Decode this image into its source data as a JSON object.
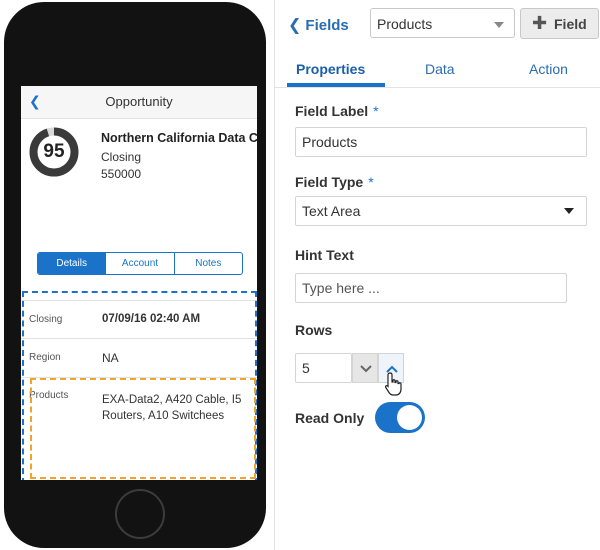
{
  "phone": {
    "header_title": "Opportunity",
    "score": "95",
    "score_fraction": 0.95,
    "opportunity_name": "Northern California Data C",
    "stage": "Closing",
    "amount": "550000",
    "segments": [
      "Details",
      "Account",
      "Notes"
    ],
    "active_segment": "Details",
    "rows": [
      {
        "label": "Closing",
        "value": "07/09/16 02:40 AM"
      },
      {
        "label": "Region",
        "value": "NA"
      }
    ],
    "products_label": "Products",
    "products_value": "EXA-Data2, A420 Cable, I5 Routers, A10 Switchees"
  },
  "panel": {
    "back_label": "Fields",
    "field_select": "Products",
    "add_field_label": "Field",
    "tabs": [
      "Properties",
      "Data",
      "Action"
    ],
    "active_tab": "Properties",
    "field_label_title": "Field Label",
    "field_label_value": "Products",
    "field_type_title": "Field Type",
    "field_type_value": "Text Area",
    "hint_text_title": "Hint Text",
    "hint_text_placeholder": "Type here ...",
    "rows_title": "Rows",
    "rows_value": "5",
    "read_only_title": "Read Only",
    "read_only_on": true,
    "required_marker": "*"
  },
  "colors": {
    "accent": "#1a73c8",
    "highlight_dash": "#f0a52a",
    "phone_body": "#121212"
  }
}
